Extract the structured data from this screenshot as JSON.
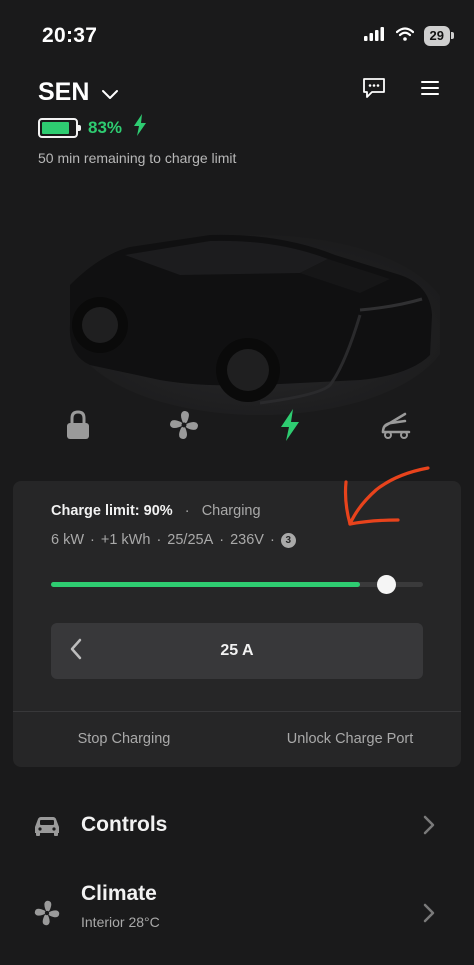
{
  "status_bar": {
    "time": "20:37",
    "battery_level": "29",
    "icons": [
      "cellular-signal-icon",
      "wifi-icon",
      "battery-icon"
    ]
  },
  "header": {
    "vehicle_name": "SEN",
    "battery_percent": "83%",
    "charge_status": "50 min remaining to charge limit",
    "battery_fill_fraction": 0.83,
    "icons": [
      "chevron-down-icon",
      "message-icon",
      "hamburger-menu-icon",
      "charging-bolt-icon"
    ]
  },
  "quick_controls": [
    {
      "name": "lock",
      "icon": "lock-icon"
    },
    {
      "name": "climate",
      "icon": "fan-icon"
    },
    {
      "name": "charge",
      "icon": "charging-bolt-icon"
    },
    {
      "name": "frunk",
      "icon": "frunk-open-icon"
    }
  ],
  "charge_card": {
    "limit_label": "Charge limit: 90%",
    "separator": "·",
    "state": "Charging",
    "stats": [
      "6 kW",
      "+1 kWh",
      "25/25A",
      "236V"
    ],
    "info_badge": "3",
    "charge_limit_fraction": 0.9,
    "charge_level_fraction": 0.83,
    "amps_value": "25 A",
    "stop_button": "Stop Charging",
    "unlock_button": "Unlock Charge Port"
  },
  "menu": [
    {
      "title": "Controls",
      "subtitle": "",
      "icon": "car-icon"
    },
    {
      "title": "Climate",
      "subtitle": "Interior 28°C",
      "icon": "fan-icon"
    }
  ],
  "colors": {
    "background": "#1a1a1b",
    "card": "#262627",
    "accent_green": "#2ecc71",
    "annotation_red": "#e8431c",
    "muted_text": "#a9a9a9"
  }
}
